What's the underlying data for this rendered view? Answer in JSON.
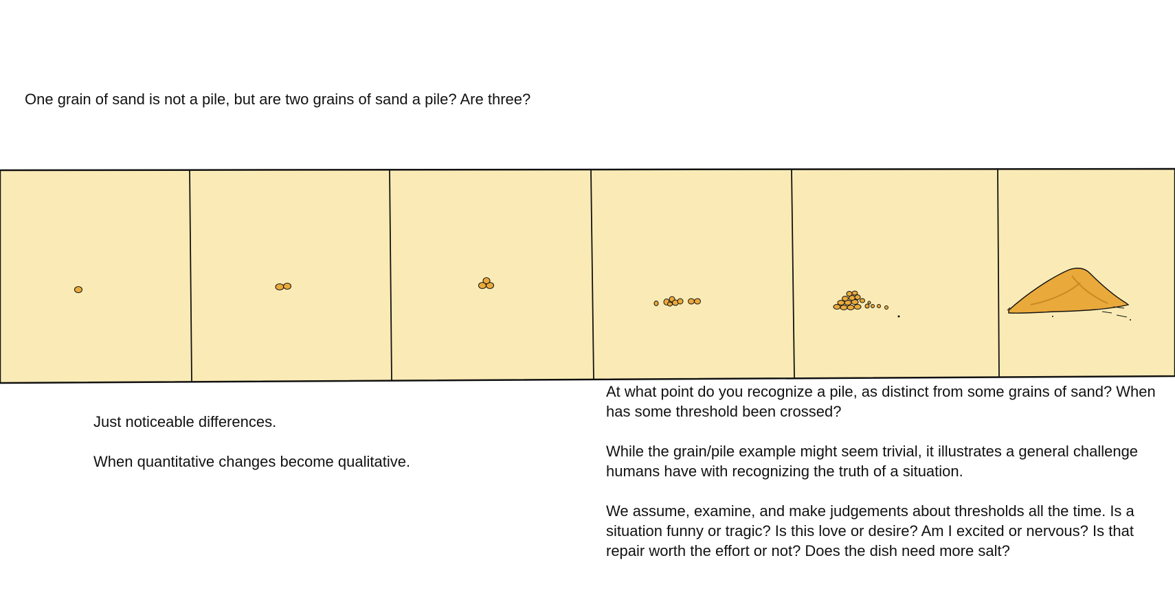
{
  "intro": "One grain of sand is not a pile, but are two grains of sand a pile? Are three?",
  "left_notes": [
    "Just noticeable differences.",
    "When quantitative changes become qualitative."
  ],
  "right_notes": [
    "At what point do you recognize a pile, as distinct from some grains of sand? When has some threshold been crossed?",
    "While the grain/pile example might seem trivial, it illustrates a general challenge humans have with recognizing the truth of a situation.",
    "We assume, examine, and make judgements about thresholds all the time. Is a situation funny or tragic? Is this love or desire? Am I excited or nervous? Is that repair worth the effort or not? Does the dish need more salt?"
  ],
  "colors": {
    "panel_fill": "#faebb6",
    "sand": "#e9a93b",
    "sand_dark": "#c98a22",
    "ink": "#111111"
  }
}
